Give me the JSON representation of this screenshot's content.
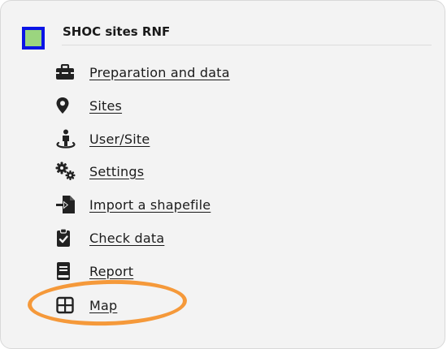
{
  "header": {
    "title": "SHOC sites RNF",
    "swatch_fill": "#9bd57f",
    "swatch_border": "#0a14e6"
  },
  "menu": {
    "items": [
      {
        "label": "Preparation and data",
        "icon": "toolbox-icon"
      },
      {
        "label": "Sites",
        "icon": "map-marker-icon"
      },
      {
        "label": "User/Site",
        "icon": "person-pin-icon"
      },
      {
        "label": "Settings",
        "icon": "gears-icon"
      },
      {
        "label": "Import a shapefile",
        "icon": "file-import-icon"
      },
      {
        "label": "Check data",
        "icon": "clipboard-check-icon"
      },
      {
        "label": "Report",
        "icon": "book-icon"
      },
      {
        "label": "Map",
        "icon": "grid-window-icon"
      }
    ]
  },
  "highlight_color": "#f5993a"
}
